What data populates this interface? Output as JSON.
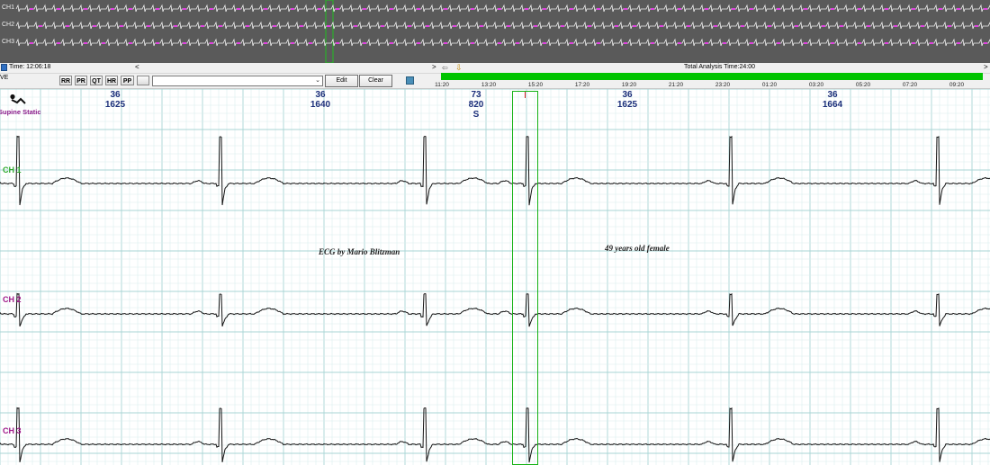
{
  "overview": {
    "channels": [
      "CH1",
      "CH2",
      "CH3"
    ]
  },
  "toolbar": {
    "time_label": "Time: 12:06:18",
    "mode_label": "VE",
    "nav_left": "<",
    "nav_right": ">",
    "buttons": [
      "RR",
      "PR",
      "QT",
      "HR",
      "PP"
    ],
    "select_value": "",
    "edit_label": "Edit",
    "clear_label": "Clear",
    "total_analysis": "Total Analysis Time:24:00"
  },
  "timeline": {
    "hours": [
      "11:20",
      "13:20",
      "15:20",
      "17:20",
      "19:20",
      "21:20",
      "23:20",
      "01:20",
      "03:20",
      "05:20",
      "07:20",
      "09:20"
    ]
  },
  "strip": {
    "posture": "Supine Static",
    "beats": [
      {
        "hr": "36",
        "rr": "1625",
        "type": ""
      },
      {
        "hr": "36",
        "rr": "1640",
        "type": ""
      },
      {
        "hr": "73",
        "rr": "820",
        "type": "S"
      },
      {
        "hr": "36",
        "rr": "1625",
        "type": ""
      },
      {
        "hr": "36",
        "rr": "1664",
        "type": ""
      }
    ],
    "channel_labels": [
      "CH 1",
      "CH 2",
      "CH 3"
    ],
    "caption_left": "ECG by Mario Blitzman",
    "caption_right": "49 years old female"
  },
  "colors": {
    "overview_bg": "#5a5a5a",
    "grid_minor": "#d6ecec",
    "grid_major": "#a9d4d4",
    "timeline_green": "#00c400",
    "cursor_green": "#15b215",
    "beat_label": "#1c2f7a",
    "ch1_label": "#2eaa2e",
    "ch2_ch3_label": "#a01a8a"
  }
}
